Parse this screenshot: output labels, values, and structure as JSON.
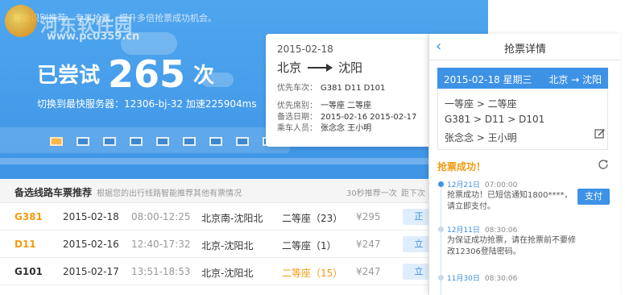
{
  "hero": {
    "watermark": "河东软件园",
    "watermark_url": "www.pc0359.cn",
    "top_text": "智能识别推荐，专享抢票，提升多倍抢票成功机会。",
    "tried_label": "已尝试",
    "tried_count": "265",
    "tried_unit": "次",
    "server_text": "切换到最快服务器：12306-bj-32  加速225904ms",
    "train_windows": 10,
    "active_window": 0
  },
  "ticket": {
    "date": "2015-02-18",
    "from": "北京",
    "to": "沈阳",
    "priority_trains_label": "优先车次：",
    "priority_trains": "G381  D11  D101",
    "priority_seats_label": "优先席别：",
    "priority_seats": "一等座  二等座",
    "alt_dates_label": "备选日期：",
    "alt_dates": "2015-02-16  2015-02-17",
    "passengers_label": "乘车人员：",
    "passengers": "张念念  王小明"
  },
  "recommend": {
    "title": "备选线路车票推荐",
    "hint": "根据您的出行线路智能推荐其他有票情况",
    "refresh": "30秒推荐一次",
    "prev": "距下次",
    "rows": [
      {
        "code": "G381",
        "date": "2015-02-18",
        "time": "08:00-12:25",
        "route": "北京南-沈阳北",
        "seat": "二等座（23）",
        "price": "¥295",
        "button": "正"
      },
      {
        "code": "D11",
        "date": "2015-02-16",
        "time": "12:40-17:32",
        "route": "北京-沈阳北",
        "seat": "二等座（1）",
        "price": "¥247",
        "button": "立"
      },
      {
        "code": "G101",
        "date": "2015-02-17",
        "time": "13:51-18:53",
        "route": "北京-沈阳北",
        "seat": "二等座（15）",
        "price": "¥247",
        "button": "立"
      }
    ]
  },
  "panel": {
    "title": "抢票详情",
    "bar_date": "2015-02-18 星期三",
    "bar_route": "北京 → 沈阳",
    "seats": "一等座 > 二等座",
    "trains": "G381 > D11 > D101",
    "passengers": "张念念 > 王小明",
    "success": "抢票成功！",
    "timeline": [
      {
        "date": "12月21日",
        "time": "07:00:00",
        "msg": "抢票成功！已短信通知1800****，请立即支付。",
        "action": "支付"
      },
      {
        "date": "12月11日",
        "time": "08:30:06",
        "msg": "为保证成功抢票，请在抢票前不要修改12306登陆密码。",
        "action": ""
      },
      {
        "date": "11月30日",
        "time": "08:30:06",
        "msg": "",
        "action": ""
      }
    ]
  },
  "colors": {
    "hero_blue": "#3f95e6",
    "accent": "#3d92e6",
    "orange": "#f29b12"
  }
}
